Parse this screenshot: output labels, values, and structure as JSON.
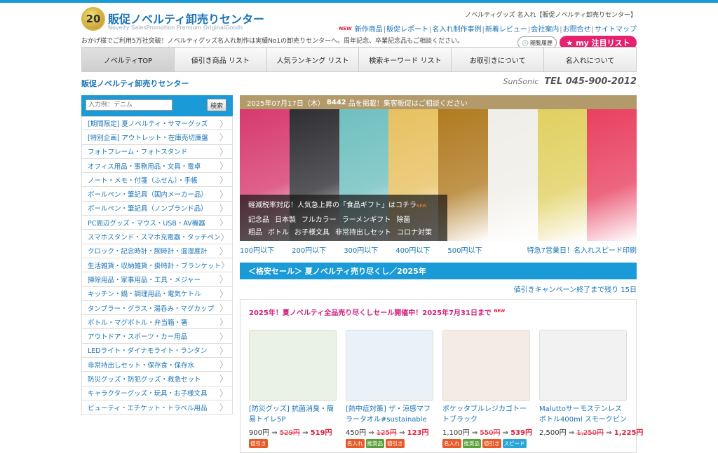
{
  "header": {
    "badge_number": "20",
    "title": "販促ノベルティ卸売りセンター",
    "subtitle": "Novelty SalesPromotion Premium OriginalGoods",
    "tagline": "おかげ様でご利用5万社突破！ノベルティグッズ名入れ制作は実績No1の卸売りセンターへ。周年記念、卒業記念品もご相談ください。",
    "top_right": "ノベルティグッズ 名入れ【販促ノベルティ卸売りセンター】",
    "new_badge": "NEW",
    "links": [
      "新作商品",
      "販促レポート",
      "名入れ制作事例",
      "新着レビュー",
      "会社案内",
      "お問合せ",
      "サイトマップ"
    ],
    "history_label": "閲覧履歴",
    "mylist_label": "my 注目リスト"
  },
  "nav": [
    "ノベルティTOP",
    "値引き商品 リスト",
    "人気ランキング リスト",
    "検索キーワード リスト",
    "お取引きについて",
    "名入れについて"
  ],
  "subheader": {
    "site_name": "販促ノベルティ卸売りセンター",
    "brand": "SunSonic",
    "tel": "TEL 045-900-2012"
  },
  "search": {
    "placeholder": "入力例：デニム",
    "button": "検索"
  },
  "categories": [
    "[期間限定] 夏ノベルティ・サマーグッズ",
    "[特別企画] アウトレット・在庫売切廉盤",
    "フォトフレーム・フォトスタンド",
    "オフィス用品・事務用品・文具・電卓",
    "ノート・メモ・付箋（ふせん）・手帳",
    "ボールペン・筆記具（国内メーカー品）",
    "ボールペン・筆記具（ノンブランド品）",
    "PC周辺グッズ・マウス・USB・AV機器",
    "スマホスタンド・スマホ充電器・タッチペン",
    "クロック・記念時計・腕時計・温湿度計",
    "生活雑貨・収納雑貨・掛時計・ブランケット",
    "掃除用品・家事用品・工具・メジャー",
    "キッチン・鍋・調理用品・電気ケトル",
    "タンブラー・グラス・湯呑み・マグカップ",
    "ボトル・マグボトル・弁当箱・箸",
    "アウトドア・スポーツ・カー用品",
    "LEDライト・ダイナモライト・ランタン",
    "非常持出しセット・保存食・保存水",
    "防災グッズ・防犯グッズ・救急セット",
    "キャラクターグッズ・玩具・お子様文具",
    "ビューティ・エチケット・トラベル用品"
  ],
  "hero": {
    "date": "2025年07月17日（木）",
    "count": "8442",
    "count_suffix": "品を掲載！集客販促はご相談ください",
    "headline": "軽減税率対応！人気急上昇の「食品ギフト」はコチラ",
    "headline_new": "NEW",
    "row1": [
      "記念品",
      "日本製",
      "フルカラー",
      "ラーメンギフト",
      "除菌"
    ],
    "row2": [
      "粗品",
      "ボトル",
      "お子様文具",
      "非常持出しセット",
      "コロナ対策"
    ],
    "colors": [
      "#d63a6e",
      "#2e2e33",
      "#6fbfbf",
      "#e8c060",
      "#b07a20",
      "#f0eee8",
      "#e0d060",
      "#e84060"
    ]
  },
  "price_links": [
    "100円以下",
    "200円以下",
    "300円以下",
    "400円以下",
    "500円以下"
  ],
  "price_links_right": "特急7営業日！名入れスピード印刷",
  "sale": {
    "heading": "＜格安セール＞ 夏ノベルティ売り尽くし／2025年",
    "countdown": "値引きキャンペーン終了まで残り 15日",
    "title": "2025年！夏ノベルティ全品売り尽くしセール開催中！2025年7月31日まで",
    "title_new": "NEW"
  },
  "products": [
    {
      "name": "[防災グッズ] 抗菌消臭・簡易トイレ5P",
      "price": "900円",
      "old": "529円",
      "new": "519円",
      "tags": [
        "値引き"
      ]
    },
    {
      "name": "[熱中症対策] ザ・涼感マフラータオル#sustainable",
      "price": "450円",
      "old": "125円",
      "new": "123円",
      "tags": [
        "名入れ",
        "推奨品",
        "値引き"
      ]
    },
    {
      "name": "ポケッタブルレジカゴトートブラック",
      "price": "1,100円",
      "old": "550円",
      "new": "539円",
      "tags": [
        "名入れ",
        "推奨品",
        "値引き",
        "スピード"
      ]
    },
    {
      "name": "Maluttoサーモステンレスボトル400ml スモークピンク",
      "price": "2,500円",
      "old": "1,250円",
      "new": "1,225円",
      "tags": []
    }
  ],
  "arrow": "⇒"
}
